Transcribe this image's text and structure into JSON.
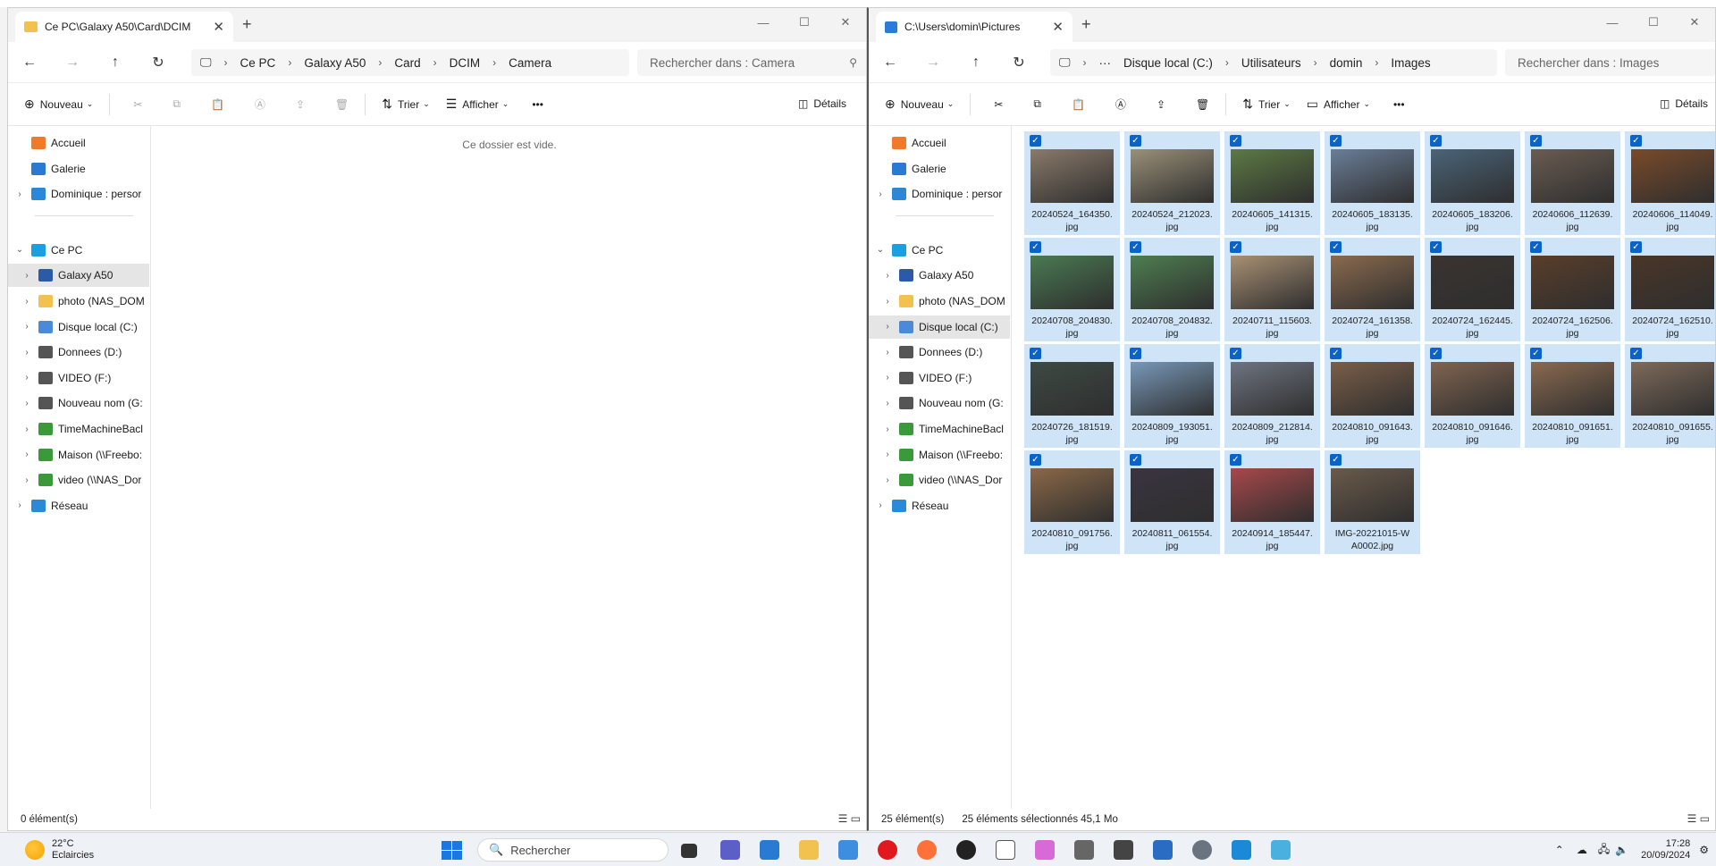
{
  "left": {
    "tab_title": "Ce PC\\Galaxy A50\\Card\\DCIM",
    "breadcrumb": [
      "Ce PC",
      "Galaxy A50",
      "Card",
      "DCIM",
      "Camera"
    ],
    "search_placeholder": "Rechercher dans : Camera",
    "toolbar": {
      "new": "Nouveau",
      "sort": "Trier",
      "view": "Afficher",
      "more": "•••",
      "details": "Détails"
    },
    "sidebar": [
      "Accueil",
      "Galerie",
      "Dominique : persor",
      "Ce PC",
      "Galaxy A50",
      "photo (NAS_DOM",
      "Disque local (C:)",
      "Donnees (D:)",
      "VIDEO (F:)",
      "Nouveau nom (G:",
      "TimeMachineBacl",
      "Maison (\\\\Freebo:",
      "video (\\\\NAS_Dor",
      "Réseau"
    ],
    "empty_message": "Ce dossier est vide.",
    "status": "0 élément(s)"
  },
  "right": {
    "tab_title": "C:\\Users\\domin\\Pictures",
    "breadcrumb": [
      "···",
      "Disque local (C:)",
      "Utilisateurs",
      "domin",
      "Images"
    ],
    "search_placeholder": "Rechercher dans : Images",
    "toolbar": {
      "new": "Nouveau",
      "sort": "Trier",
      "view": "Afficher",
      "more": "•••",
      "details": "Détails"
    },
    "sidebar": [
      "Accueil",
      "Galerie",
      "Dominique : persor",
      "Ce PC",
      "Galaxy A50",
      "photo (NAS_DOM",
      "Disque local (C:)",
      "Donnees (D:)",
      "VIDEO (F:)",
      "Nouveau nom (G:",
      "TimeMachineBacl",
      "Maison (\\\\Freebo:",
      "video (\\\\NAS_Dor",
      "Réseau"
    ],
    "files": [
      {
        "name": "20240524_164350.\njpg",
        "color": "#8a7a6a"
      },
      {
        "name": "20240524_212023.\njpg",
        "color": "#9a9078"
      },
      {
        "name": "20240605_141315.\njpg",
        "color": "#5c7a44"
      },
      {
        "name": "20240605_183135.\njpg",
        "color": "#6a7e98"
      },
      {
        "name": "20240605_183206.\njpg",
        "color": "#4a6478"
      },
      {
        "name": "20240606_112639.\njpg",
        "color": "#6a5c52"
      },
      {
        "name": "20240606_114049.\njpg",
        "color": "#7a4a2a"
      },
      {
        "name": "20240708_204830.\njpg",
        "color": "#4a7a52"
      },
      {
        "name": "20240708_204832.\njpg",
        "color": "#4e7e50"
      },
      {
        "name": "20240711_115603.\njpg",
        "color": "#a89074"
      },
      {
        "name": "20240724_161358.\njpg",
        "color": "#8a6a4e"
      },
      {
        "name": "20240724_162445.\njpg",
        "color": "#3a3430"
      },
      {
        "name": "20240724_162506.\njpg",
        "color": "#5a3e2a"
      },
      {
        "name": "20240724_162510.\njpg",
        "color": "#4a3628"
      },
      {
        "name": "20240726_181519.\njpg",
        "color": "#3e4a44"
      },
      {
        "name": "20240809_193051.\njpg",
        "color": "#7898b8"
      },
      {
        "name": "20240809_212814.\njpg",
        "color": "#6e7480"
      },
      {
        "name": "20240810_091643.\njpg",
        "color": "#7a5e48"
      },
      {
        "name": "20240810_091646.\njpg",
        "color": "#806450"
      },
      {
        "name": "20240810_091651.\njpg",
        "color": "#8a6a50"
      },
      {
        "name": "20240810_091655.\njpg",
        "color": "#7e6a5a"
      },
      {
        "name": "20240810_091756.\njpg",
        "color": "#8a6848"
      },
      {
        "name": "20240811_061554.\njpg",
        "color": "#3a3440"
      },
      {
        "name": "20240914_185447.\njpg",
        "color": "#a8484a"
      },
      {
        "name": "IMG-20221015-W\nA0002.jpg",
        "color": "#6a5a4a"
      }
    ],
    "status_count": "25 élément(s)",
    "status_selected": "25 éléments sélectionnés  45,1 Mo"
  },
  "taskbar": {
    "weather_temp": "22°C",
    "weather_desc": "Eclaircies",
    "search": "Rechercher",
    "time": "17:28",
    "date": "20/09/2024"
  }
}
